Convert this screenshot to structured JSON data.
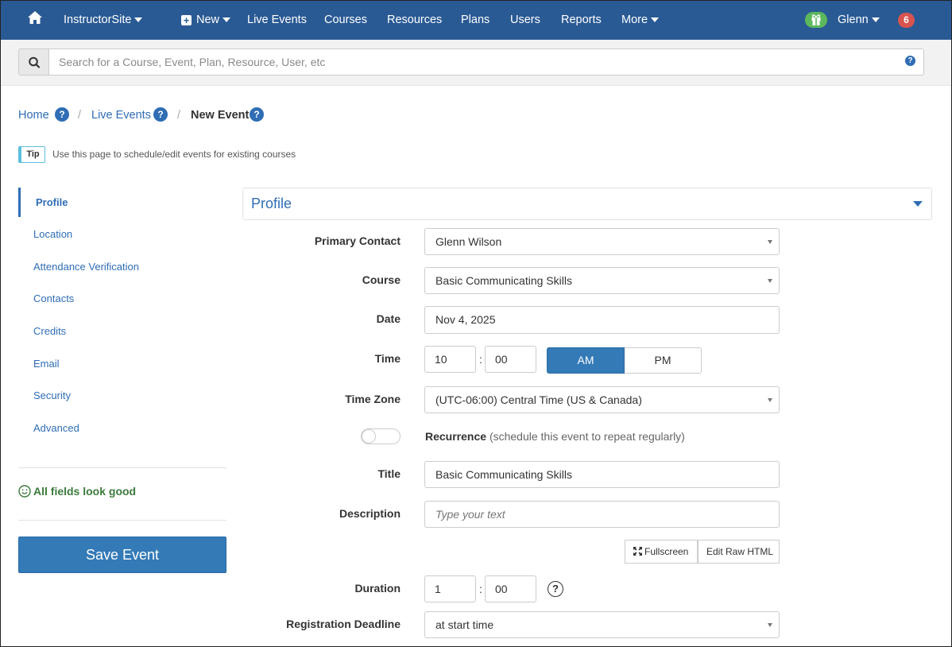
{
  "nav": {
    "brand": "InstructorSite",
    "new": "New",
    "items": [
      "Live Events",
      "Courses",
      "Resources",
      "Plans",
      "Users",
      "Reports"
    ],
    "more": "More",
    "user": "Glenn",
    "notifications": "6"
  },
  "search": {
    "placeholder": "Search for a Course, Event, Plan, Resource, User, etc",
    "help": "?"
  },
  "breadcrumb": {
    "home": "Home",
    "live_events": "Live Events",
    "current": "New Event",
    "sep": "/",
    "help": "?"
  },
  "tip": {
    "badge": "Tip",
    "text": "Use this page to schedule/edit events for existing courses"
  },
  "sidenav": {
    "items": [
      "Profile",
      "Location",
      "Attendance Verification",
      "Contacts",
      "Credits",
      "Email",
      "Security",
      "Advanced"
    ],
    "status": "All fields look good",
    "save": "Save Event"
  },
  "panel": {
    "title": "Profile"
  },
  "form": {
    "primary_contact": {
      "label": "Primary Contact",
      "value": "Glenn Wilson"
    },
    "course": {
      "label": "Course",
      "value": "Basic Communicating Skills"
    },
    "date": {
      "label": "Date",
      "value": "Nov 4, 2025"
    },
    "time": {
      "label": "Time",
      "hour": "10",
      "minute": "00",
      "am": "AM",
      "pm": "PM",
      "sep": ":"
    },
    "timezone": {
      "label": "Time Zone",
      "value": "(UTC-06:00) Central Time (US & Canada)"
    },
    "recurrence": {
      "label": "Recurrence",
      "hint": "(schedule this event to repeat regularly)"
    },
    "title": {
      "label": "Title",
      "value": "Basic Communicating Skills"
    },
    "description": {
      "label": "Description",
      "placeholder": "Type your text"
    },
    "fullscreen": "Fullscreen",
    "edit_raw": "Edit Raw HTML",
    "duration": {
      "label": "Duration",
      "hours": "1",
      "minutes": "00",
      "sep": ":",
      "help": "?"
    },
    "deadline": {
      "label": "Registration Deadline",
      "value": "at start time"
    }
  }
}
